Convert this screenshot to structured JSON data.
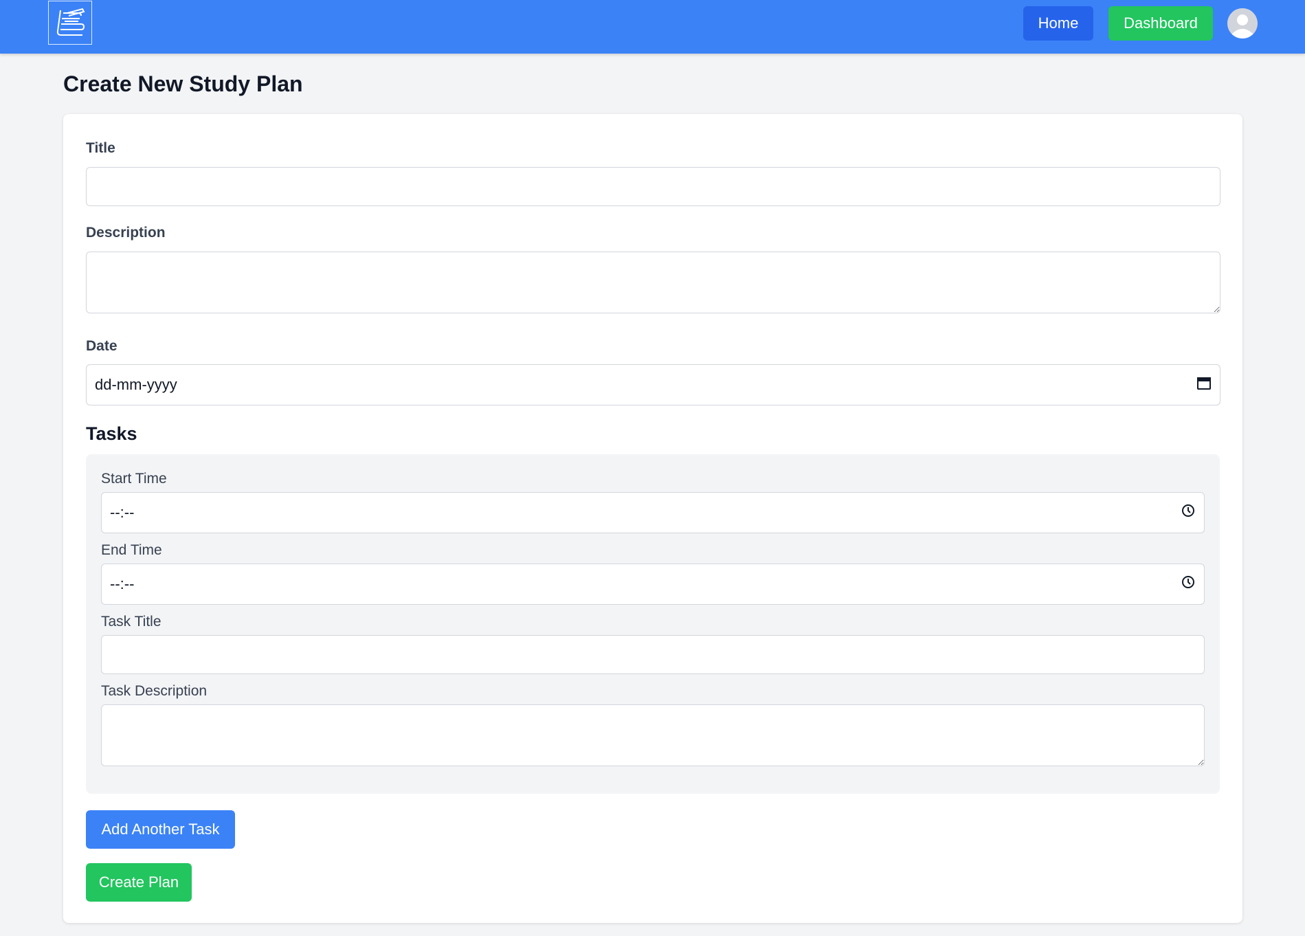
{
  "navbar": {
    "logo_icon": "books-icon",
    "home_label": "Home",
    "dashboard_label": "Dashboard",
    "avatar_icon": "user-avatar-icon",
    "colors": {
      "bar": "#3b82f6",
      "home": "#2563eb",
      "dashboard": "#22c55e"
    }
  },
  "page": {
    "title": "Create New Study Plan"
  },
  "form": {
    "title_label": "Title",
    "title_value": "",
    "description_label": "Description",
    "description_value": "",
    "date_label": "Date",
    "date_value": "dd-mm-yyyy",
    "date_icon": "calendar-icon",
    "tasks_heading": "Tasks",
    "task": {
      "start_time_label": "Start Time",
      "start_time_value": "--:--",
      "end_time_label": "End Time",
      "end_time_value": "--:--",
      "clock_icon": "clock-icon",
      "task_title_label": "Task Title",
      "task_title_value": "",
      "task_description_label": "Task Description",
      "task_description_value": ""
    },
    "add_task_label": "Add Another Task",
    "create_plan_label": "Create Plan"
  }
}
